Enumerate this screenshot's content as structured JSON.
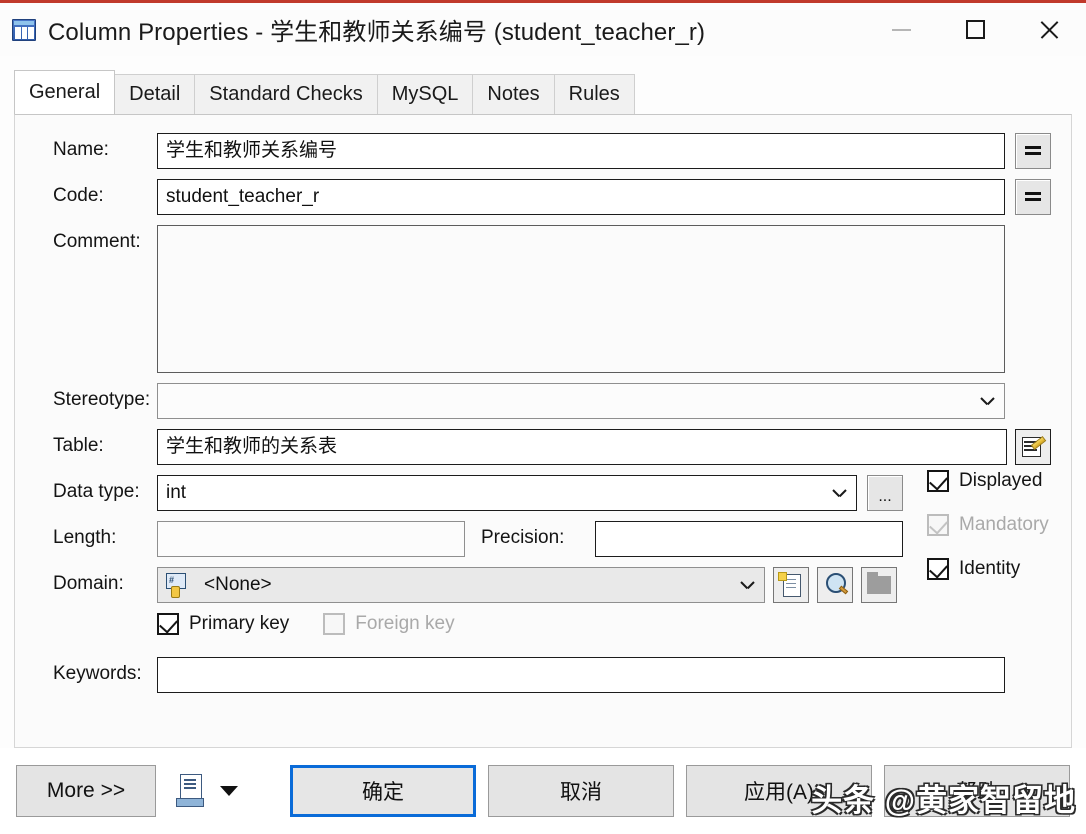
{
  "window": {
    "title": "Column Properties - 学生和教师关系编号 (student_teacher_r)",
    "icon": "table-column-icon",
    "accent_color": "#c0392b",
    "controls": {
      "minimize": "minimize-icon",
      "maximize": "maximize-icon",
      "close": "close-icon"
    }
  },
  "tabs": [
    {
      "label": "General",
      "active": true
    },
    {
      "label": "Detail",
      "active": false
    },
    {
      "label": "Standard Checks",
      "active": false
    },
    {
      "label": "MySQL",
      "active": false
    },
    {
      "label": "Notes",
      "active": false
    },
    {
      "label": "Rules",
      "active": false
    }
  ],
  "form": {
    "name": {
      "label": "Name:",
      "value": "学生和教师关系编号",
      "button": "="
    },
    "code": {
      "label": "Code:",
      "value": "student_teacher_r",
      "button": "="
    },
    "comment": {
      "label": "Comment:",
      "value": ""
    },
    "stereotype": {
      "label": "Stereotype:",
      "value": ""
    },
    "table": {
      "label": "Table:",
      "value": "学生和教师的关系表"
    },
    "data_type": {
      "label": "Data type:",
      "value": "int",
      "ellipsis_button": "..."
    },
    "length": {
      "label": "Length:",
      "value": ""
    },
    "precision": {
      "label": "Precision:",
      "value": ""
    },
    "domain": {
      "label": "Domain:",
      "value": "<None>"
    },
    "keywords": {
      "label": "Keywords:",
      "value": ""
    }
  },
  "checkboxes": {
    "displayed": {
      "label": "Displayed",
      "checked": true,
      "enabled": true
    },
    "mandatory": {
      "label": "Mandatory",
      "checked": true,
      "enabled": false
    },
    "identity": {
      "label": "Identity",
      "checked": true,
      "enabled": true
    },
    "primary_key": {
      "label": "Primary key",
      "checked": true,
      "enabled": true
    },
    "foreign_key": {
      "label": "Foreign key",
      "checked": false,
      "enabled": false
    }
  },
  "footer": {
    "more": "More >>",
    "report_icon": "print-report-icon",
    "dropdown_icon": "caret-down-icon",
    "ok": "确定",
    "cancel": "取消",
    "apply": "应用(A)",
    "help": "帮助",
    "focus_color": "#0a6bd8"
  },
  "watermark": {
    "text": "头条 @黄家智留地"
  }
}
